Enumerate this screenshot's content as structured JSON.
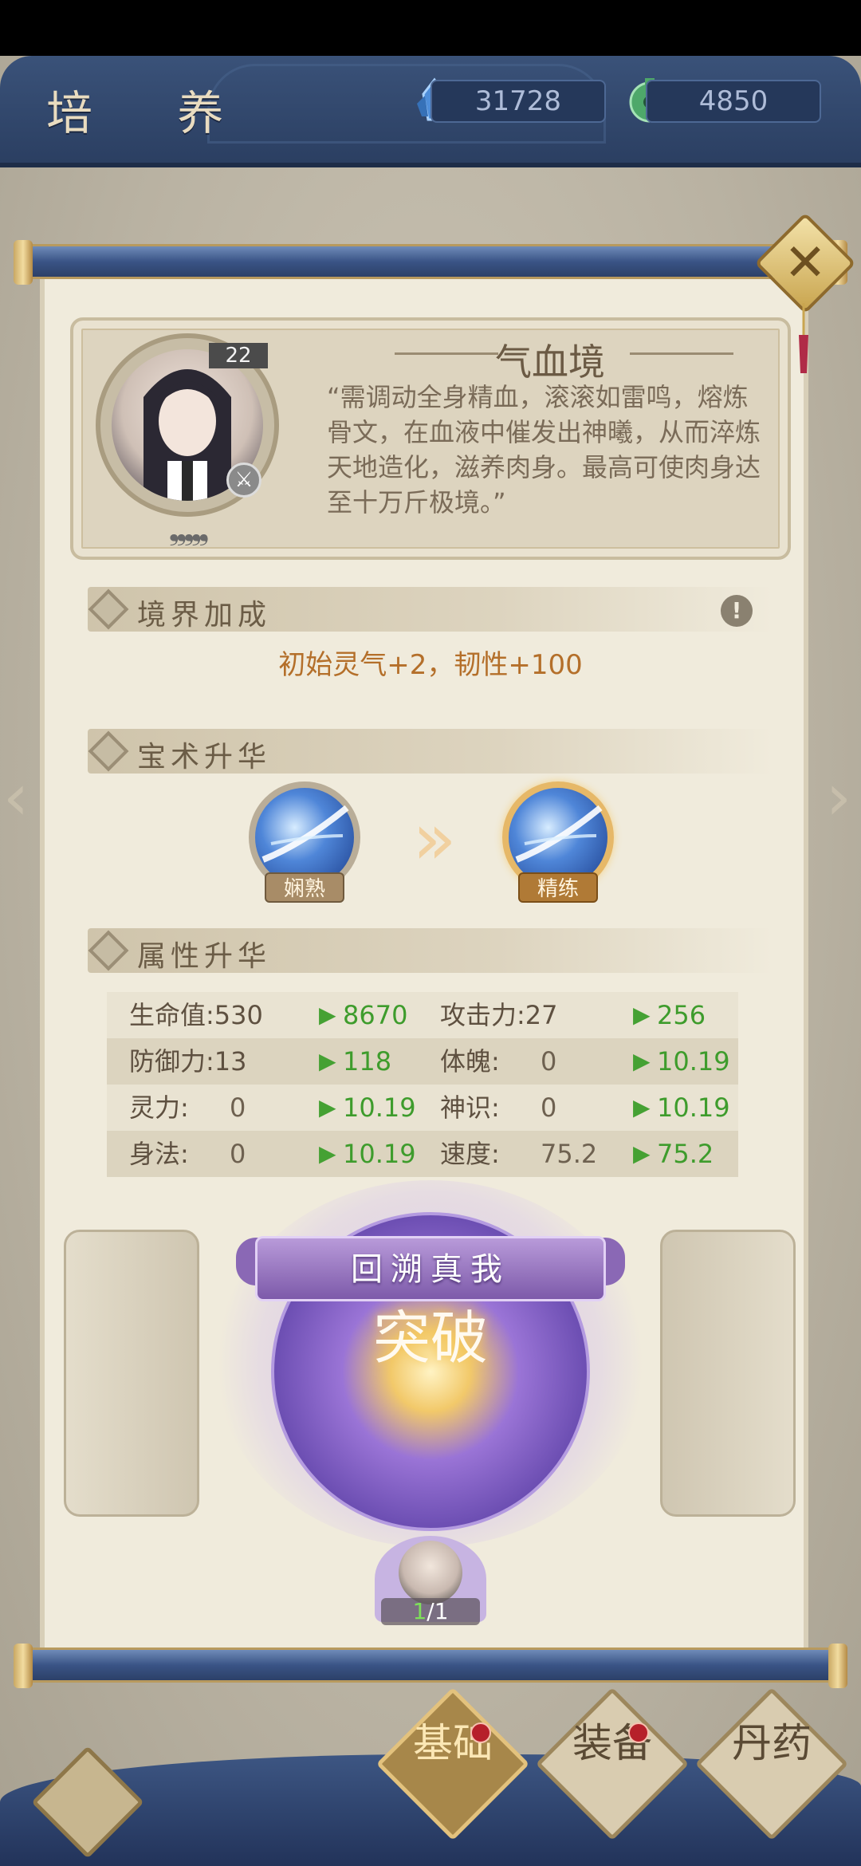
{
  "header": {
    "title": "培 养",
    "currencies": [
      {
        "icon": "crystal-icon",
        "value": "31728"
      },
      {
        "icon": "jade-coin-icon",
        "value": "4850"
      }
    ]
  },
  "character": {
    "level": "22",
    "star_count": 5,
    "stars": "❟❟❟❟❟",
    "weapon_icon": "sword-badge-icon"
  },
  "realm": {
    "title": "气血境",
    "description": "“需调动全身精血，滚滚如雷鸣，熔炼骨文，在血液中催发出神曦，从而淬炼天地造化，滋养肉身。最高可使肉身达至十万斤极境。”"
  },
  "sections": {
    "realm_bonus": {
      "label": "境界加成",
      "text": "初始灵气+2，韧性+100"
    },
    "skill_upgrade": {
      "label": "宝术升华",
      "before": "娴熟",
      "after": "精练"
    },
    "attr_upgrade": {
      "label": "属性升华"
    }
  },
  "attributes": [
    {
      "name1": "生命值:530",
      "new1": "8670",
      "name2": "攻击力:27",
      "new2": "256"
    },
    {
      "name1": "防御力:13",
      "new1": "118",
      "name2": "体魄:",
      "val2": "0",
      "new2": "10.19"
    },
    {
      "name1": "灵力:",
      "val1": "0",
      "new1": "10.19",
      "name2": "神识:",
      "val2": "0",
      "new2": "10.19"
    },
    {
      "name1": "身法:",
      "val1": "0",
      "new1": "10.19",
      "name2": "速度:",
      "val2": "75.2",
      "new2": "75.2"
    }
  ],
  "breakthrough": {
    "banner": "回溯真我",
    "orb_text": "突破",
    "attempts_current": "1",
    "attempts_sep_total": "/1"
  },
  "nav": {
    "base": "基础",
    "equip": "装备",
    "pill": "丹药"
  },
  "colors": {
    "increase_green": "#3e9c2c",
    "bonus_orange": "#b46f2a",
    "header_blue": "#3a5279"
  }
}
